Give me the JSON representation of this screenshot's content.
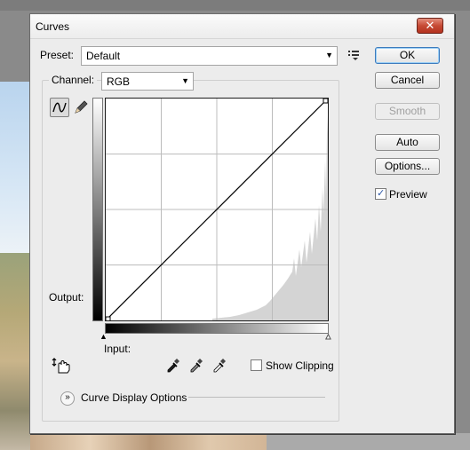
{
  "window": {
    "title": "Curves",
    "close_label": "✕"
  },
  "preset": {
    "label": "Preset:",
    "value": "Default"
  },
  "channel": {
    "label": "Channel:",
    "value": "RGB"
  },
  "graph": {
    "output_label": "Output:",
    "input_label": "Input:"
  },
  "buttons": {
    "ok": "OK",
    "cancel": "Cancel",
    "smooth": "Smooth",
    "auto": "Auto",
    "options": "Options..."
  },
  "preview": {
    "label": "Preview",
    "checked": true
  },
  "show_clipping": {
    "label": "Show Clipping",
    "checked": false
  },
  "curve_display_options": {
    "label": "Curve Display Options"
  },
  "icons": {
    "curve_tool": "curve-icon",
    "pencil_tool": "pencil-icon",
    "target_adjust": "hand-target-icon",
    "black_point": "eyedropper-black-icon",
    "gray_point": "eyedropper-gray-icon",
    "white_point": "eyedropper-white-icon",
    "preset_menu": "preset-menu-icon",
    "expand": "expand-chevron-icon"
  },
  "colors": {
    "dialog_bg": "#ececec",
    "close_button": "#c64a35",
    "default_button_border": "#3d7bbd",
    "histogram": "#d4d4d4"
  }
}
